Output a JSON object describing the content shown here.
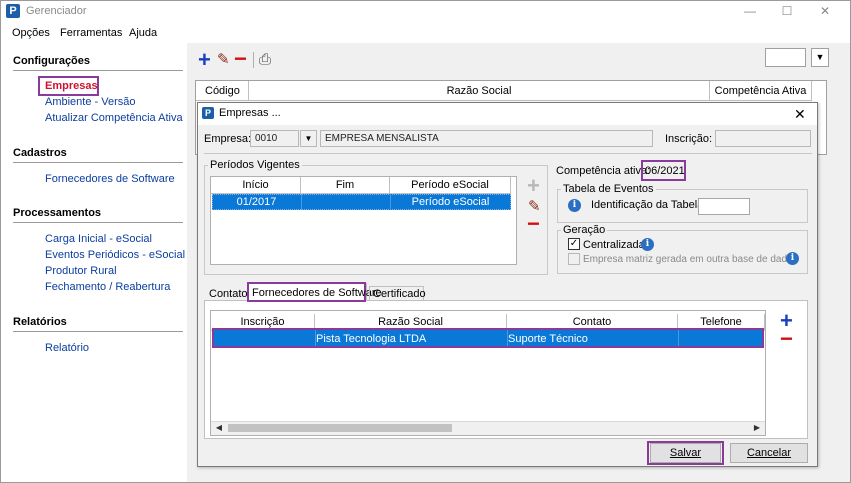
{
  "window": {
    "title": "Gerenciador",
    "minimize": "—",
    "maximize": "☐",
    "close": "✕"
  },
  "menu": [
    "Opções",
    "Ferramentas",
    "Ajuda"
  ],
  "sidebar": {
    "sections": [
      {
        "title": "Configurações",
        "items": [
          "Empresas",
          "Ambiente - Versão",
          "Atualizar Competência Ativa"
        ]
      },
      {
        "title": "Cadastros",
        "items": [
          "Fornecedores de Software"
        ]
      },
      {
        "title": "Processamentos",
        "items": [
          "Carga Inicial - eSocial",
          "Eventos Periódicos - eSocial",
          "Produtor Rural",
          "Fechamento / Reabertura"
        ]
      },
      {
        "title": "Relatórios",
        "items": [
          "Relatório"
        ]
      }
    ]
  },
  "toolbar": {
    "add": "+",
    "edit": "✎",
    "remove": "−",
    "print": "⎙",
    "combo_arrow": "▼"
  },
  "main_grid": {
    "columns": [
      "Código",
      "Razão Social",
      "Competência Ativa"
    ]
  },
  "dialog": {
    "title": "Empresas ...",
    "close": "✕",
    "empresa_label": "Empresa:",
    "empresa_code": "0010",
    "empresa_name": "EMPRESA MENSALISTA",
    "inscricao_label": "Inscrição:",
    "inscricao_value": "",
    "periodos": {
      "title": "Períodos Vigentes",
      "columns": [
        "Início",
        "Fim",
        "Período eSocial"
      ],
      "rows": [
        {
          "inicio": "01/2017",
          "fim": "",
          "periodo": "Período eSocial"
        }
      ]
    },
    "competencia_label": "Competência ativa:",
    "competencia_value": "06/2021",
    "tabela_eventos": {
      "title": "Tabela de Eventos",
      "label": "Identificação da Tabela",
      "value": ""
    },
    "geracao": {
      "title": "Geração",
      "centralizada_label": "Centralizada",
      "centralizada_checked": "✓",
      "matriz_label": "Empresa matriz gerada em outra base de dados"
    },
    "tabs": [
      "Contato",
      "Fornecedores de Software",
      "Certificado"
    ],
    "active_tab": "Fornecedores de Software",
    "fornecedores": {
      "columns": [
        "Inscrição",
        "Razão Social",
        "Contato",
        "Telefone"
      ],
      "rows": [
        {
          "inscricao": "",
          "razao": "Pista Tecnologia LTDA",
          "contato": "Suporte Técnico",
          "telefone": ""
        }
      ]
    },
    "buttons": {
      "save": "Salvar",
      "cancel": "Cancelar"
    },
    "scroll": {
      "left": "◀",
      "right": "▶"
    }
  },
  "colors": {
    "accent": "#0a78d7",
    "highlight": "#8a3a9a",
    "link": "#0b3e9e",
    "add": "#1a3fbf",
    "remove": "#d01010"
  }
}
